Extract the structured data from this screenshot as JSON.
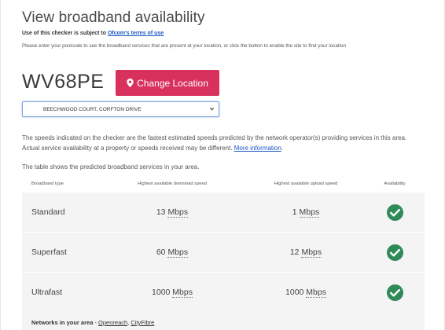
{
  "page": {
    "title": "View broadband availability",
    "terms_prefix": "Use of this checker is subject to ",
    "terms_link": "Ofcom's terms of use",
    "intro": "Please enter your postcode to see the broadband services that are present at your location, or click the button to enable the site to find your location"
  },
  "location": {
    "postcode": "WV68PE",
    "change_button": "Change Location",
    "address_selected": "BEECHWOOD COURT, CORFTON DRIVE"
  },
  "notes": {
    "speeds": "The speeds indicated on the checker are the fastest estimated speeds predicted by the network operator(s) providing services in this area. Actual service availability at a property or speeds received may be different. ",
    "more_info_link": "More information",
    "speeds_end": ".",
    "table_intro": "The table shows the predicted broadband services in your area."
  },
  "table": {
    "headers": {
      "type": "Broadband type",
      "download": "Highest available download speed",
      "upload": "Highest available upload speed",
      "availability": "Availability"
    },
    "rows": [
      {
        "type": "Standard",
        "download": "13",
        "download_unit": "Mbps",
        "upload": "1",
        "upload_unit": "Mbps",
        "available": true
      },
      {
        "type": "Superfast",
        "download": "60",
        "download_unit": "Mbps",
        "upload": "12",
        "upload_unit": "Mbps",
        "available": true
      },
      {
        "type": "Ultrafast",
        "download": "1000",
        "download_unit": "Mbps",
        "upload": "1000",
        "upload_unit": "Mbps",
        "available": true
      }
    ]
  },
  "networks": {
    "label": "Networks in your area",
    "separator": " - ",
    "items": [
      "Openreach",
      "CityFibre"
    ],
    "joiner": ", "
  },
  "colors": {
    "button": "#d9315e",
    "link": "#1a57c4",
    "check": "#2e8b57"
  }
}
